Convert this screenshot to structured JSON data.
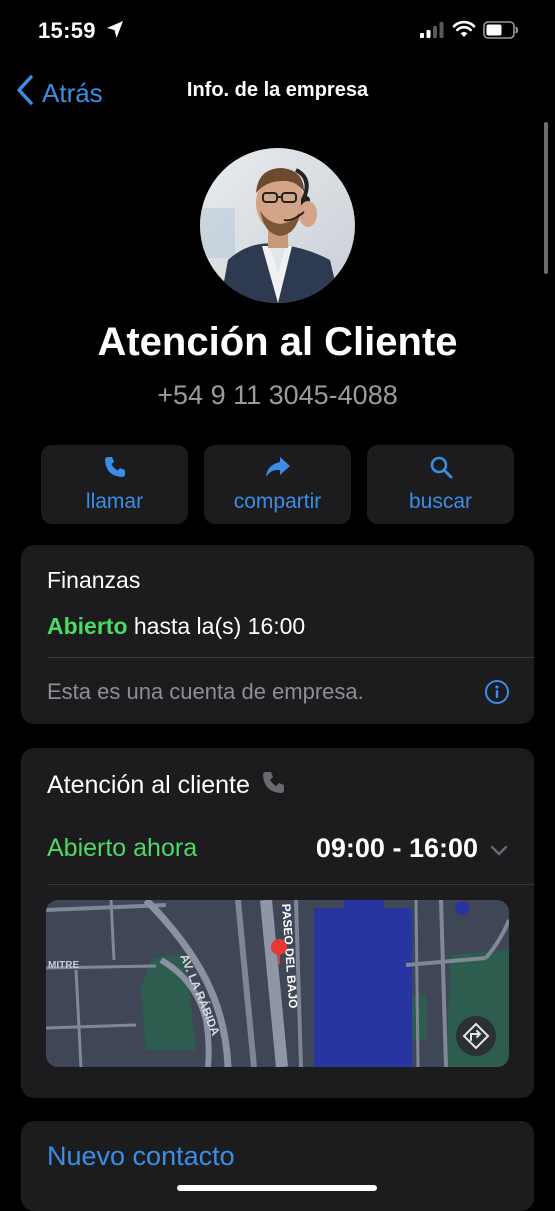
{
  "status_bar": {
    "time": "15:59"
  },
  "nav": {
    "back_label": "Atrás",
    "title": "Info. de la empresa"
  },
  "profile": {
    "name": "Atención al Cliente",
    "phone": "+54 9 11 3045-4088"
  },
  "actions": [
    {
      "label": "llamar",
      "icon": "phone-icon"
    },
    {
      "label": "compartir",
      "icon": "share-icon"
    },
    {
      "label": "buscar",
      "icon": "search-icon"
    }
  ],
  "business_card": {
    "category": "Finanzas",
    "open_status": "Abierto",
    "open_until": "hasta la(s) 16:00",
    "note": "Esta es una cuenta de empresa."
  },
  "hours_card": {
    "title": "Atención al cliente",
    "status": "Abierto ahora",
    "hours": "09:00 - 16:00",
    "map_labels": [
      "MITRE",
      "AV. LA RÁBIDA",
      "PASEO DEL BAJO"
    ]
  },
  "contact": {
    "label": "Nuevo contacto"
  },
  "colors": {
    "accent": "#3a8ee6",
    "open": "#4cd964",
    "card": "#1c1c1e",
    "background": "#000000"
  }
}
